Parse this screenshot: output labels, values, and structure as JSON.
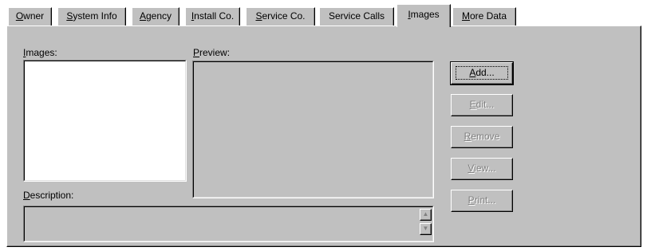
{
  "tabs": [
    {
      "label": "Owner",
      "mnemonic": "O",
      "rest": "wner"
    },
    {
      "label": "System Info",
      "mnemonic": "S",
      "rest": "ystem Info"
    },
    {
      "label": "Agency",
      "mnemonic": "A",
      "rest": "gency"
    },
    {
      "label": "Install Co.",
      "mnemonic": "I",
      "rest": "nstall Co."
    },
    {
      "label": "Service Co.",
      "mnemonic": "S",
      "rest": "ervice Co."
    },
    {
      "label": "Service Calls",
      "pre": "Service Calls"
    },
    {
      "label": "Images",
      "mnemonic": "I",
      "rest": "mages",
      "active": true
    },
    {
      "label": "More Data",
      "mnemonic": "M",
      "rest": "ore Data"
    }
  ],
  "images_label": {
    "mnemonic": "I",
    "rest": "mages:"
  },
  "preview_label": {
    "mnemonic": "P",
    "rest": "review:"
  },
  "description_label": {
    "mnemonic": "D",
    "rest": "escription:"
  },
  "buttons": {
    "add": {
      "mnemonic": "A",
      "rest": "dd..."
    },
    "edit": {
      "mnemonic": "E",
      "rest": "dit..."
    },
    "remove": {
      "mnemonic": "R",
      "rest": "emove"
    },
    "view": {
      "mnemonic": "V",
      "rest": "iew..."
    },
    "print": {
      "mnemonic": "P",
      "rest": "rint..."
    }
  },
  "scroll_icons": {
    "up": "scroll-up-arrow",
    "down": "scroll-down-arrow"
  }
}
